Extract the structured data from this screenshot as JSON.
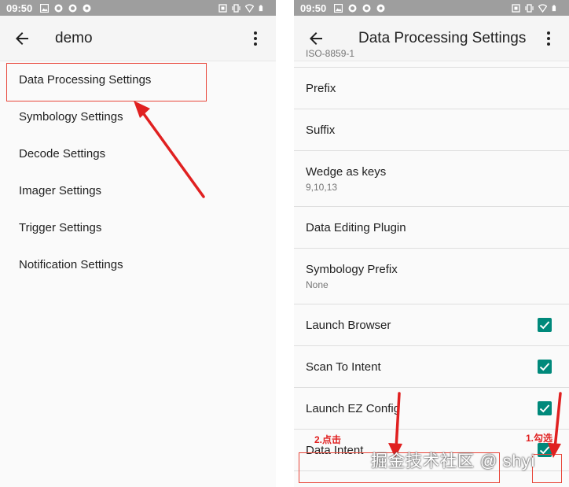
{
  "status_bar": {
    "time": "09:50"
  },
  "left_screen": {
    "title": "demo",
    "menu_items": [
      "Data Processing Settings",
      "Symbology Settings",
      "Decode Settings",
      "Imager Settings",
      "Trigger Settings",
      "Notification Settings"
    ]
  },
  "right_screen": {
    "title": "Data Processing Settings",
    "partial_summary": "ISO-8859-1",
    "prefs": [
      {
        "title": "Prefix"
      },
      {
        "title": "Suffix"
      },
      {
        "title": "Wedge as keys",
        "summary": "9,10,13"
      },
      {
        "title": "Data Editing Plugin"
      },
      {
        "title": "Symbology Prefix",
        "summary": "None"
      },
      {
        "title": "Launch Browser",
        "checked": true
      },
      {
        "title": "Scan To Intent",
        "checked": true
      },
      {
        "title": "Launch EZ Config",
        "checked": true
      },
      {
        "title": "Data Intent",
        "checked": true
      }
    ]
  },
  "annotations": {
    "step1": "1.勾选",
    "step2": "2.点击",
    "watermark": "掘金技术社区 @ shyi",
    "color": "#e02020"
  },
  "colors": {
    "status_bar": "#9e9e9e",
    "checkbox": "#00897b",
    "background": "#fafafa"
  }
}
